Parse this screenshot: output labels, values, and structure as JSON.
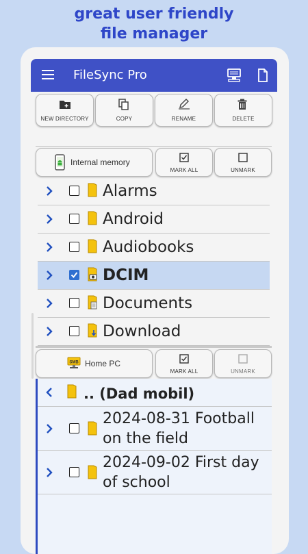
{
  "promo": {
    "line1": "great user friendly",
    "line2": "file manager"
  },
  "appbar": {
    "title": "FileSync Pro",
    "icons": [
      "menu-icon",
      "monitor-icon",
      "document-icon"
    ]
  },
  "toolbar": {
    "new_directory": "NEW DIRECTORY",
    "copy": "COPY",
    "rename": "RENAME",
    "delete": "DELETE"
  },
  "local_pane": {
    "location": "Internal memory",
    "mark_all": "MARK ALL",
    "unmark": "UNMARK",
    "items": [
      {
        "name": "Alarms",
        "checked": false
      },
      {
        "name": "Android",
        "checked": false
      },
      {
        "name": "Audiobooks",
        "checked": false
      },
      {
        "name": "DCIM",
        "checked": true
      },
      {
        "name": "Documents",
        "checked": false
      },
      {
        "name": "Download",
        "checked": false
      }
    ]
  },
  "remote_pane": {
    "location": "Home PC",
    "location_badge": "SMB",
    "mark_all": "MARK ALL",
    "unmark": "UNMARK",
    "parent": ".. (Dad mobil)",
    "items": [
      {
        "name": "2024-08-31 Football on the field",
        "checked": false
      },
      {
        "name": "2024-09-02 First day of school",
        "checked": false
      }
    ]
  },
  "colors": {
    "accent": "#3f51c6",
    "folder": "#f4c20d",
    "selected_row": "#c6d8f2",
    "background": "#c7d9f3"
  }
}
